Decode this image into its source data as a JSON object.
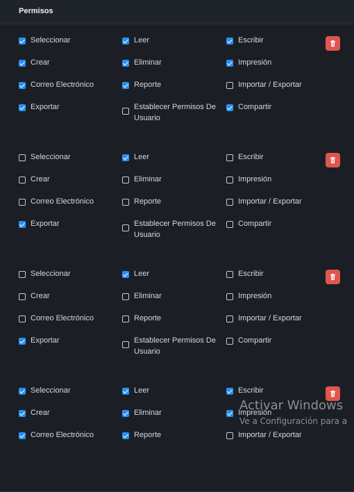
{
  "header": {
    "title": "Permisos"
  },
  "groups": [
    {
      "perms": [
        {
          "label": "Seleccionar",
          "checked": true
        },
        {
          "label": "Leer",
          "checked": true
        },
        {
          "label": "Escribir",
          "checked": true
        },
        {
          "label": "Crear",
          "checked": true
        },
        {
          "label": "Eliminar",
          "checked": true
        },
        {
          "label": "Impresión",
          "checked": true
        },
        {
          "label": "Correo Electrónico",
          "checked": true
        },
        {
          "label": "Reporte",
          "checked": true
        },
        {
          "label": "Importar / Exportar",
          "checked": false
        },
        {
          "label": "Exportar",
          "checked": true
        },
        {
          "label": "Establecer Permisos De Usuario",
          "checked": false
        },
        {
          "label": "Compartir",
          "checked": true
        }
      ]
    },
    {
      "perms": [
        {
          "label": "Seleccionar",
          "checked": false
        },
        {
          "label": "Leer",
          "checked": true
        },
        {
          "label": "Escribir",
          "checked": false
        },
        {
          "label": "Crear",
          "checked": false
        },
        {
          "label": "Eliminar",
          "checked": false
        },
        {
          "label": "Impresión",
          "checked": false
        },
        {
          "label": "Correo Electrónico",
          "checked": false
        },
        {
          "label": "Reporte",
          "checked": false
        },
        {
          "label": "Importar / Exportar",
          "checked": false
        },
        {
          "label": "Exportar",
          "checked": true
        },
        {
          "label": "Establecer Permisos De Usuario",
          "checked": false
        },
        {
          "label": "Compartir",
          "checked": false
        }
      ]
    },
    {
      "perms": [
        {
          "label": "Seleccionar",
          "checked": false
        },
        {
          "label": "Leer",
          "checked": true
        },
        {
          "label": "Escribir",
          "checked": false
        },
        {
          "label": "Crear",
          "checked": false
        },
        {
          "label": "Eliminar",
          "checked": false
        },
        {
          "label": "Impresión",
          "checked": false
        },
        {
          "label": "Correo Electrónico",
          "checked": false
        },
        {
          "label": "Reporte",
          "checked": false
        },
        {
          "label": "Importar / Exportar",
          "checked": false
        },
        {
          "label": "Exportar",
          "checked": true
        },
        {
          "label": "Establecer Permisos De Usuario",
          "checked": false
        },
        {
          "label": "Compartir",
          "checked": false
        }
      ]
    },
    {
      "perms": [
        {
          "label": "Seleccionar",
          "checked": true
        },
        {
          "label": "Leer",
          "checked": true
        },
        {
          "label": "Escribir",
          "checked": true
        },
        {
          "label": "Crear",
          "checked": true
        },
        {
          "label": "Eliminar",
          "checked": true
        },
        {
          "label": "Impresión",
          "checked": true
        },
        {
          "label": "Correo Electrónico",
          "checked": true
        },
        {
          "label": "Reporte",
          "checked": true
        },
        {
          "label": "Importar / Exportar",
          "checked": false
        }
      ]
    }
  ],
  "delete_icon": "trash-icon",
  "colors": {
    "accent": "#2b8ff1",
    "danger": "#e0564f",
    "background": "#1b1f25"
  },
  "watermark": {
    "title": "Activar Windows",
    "subtitle": "Ve a Configuración para a"
  }
}
